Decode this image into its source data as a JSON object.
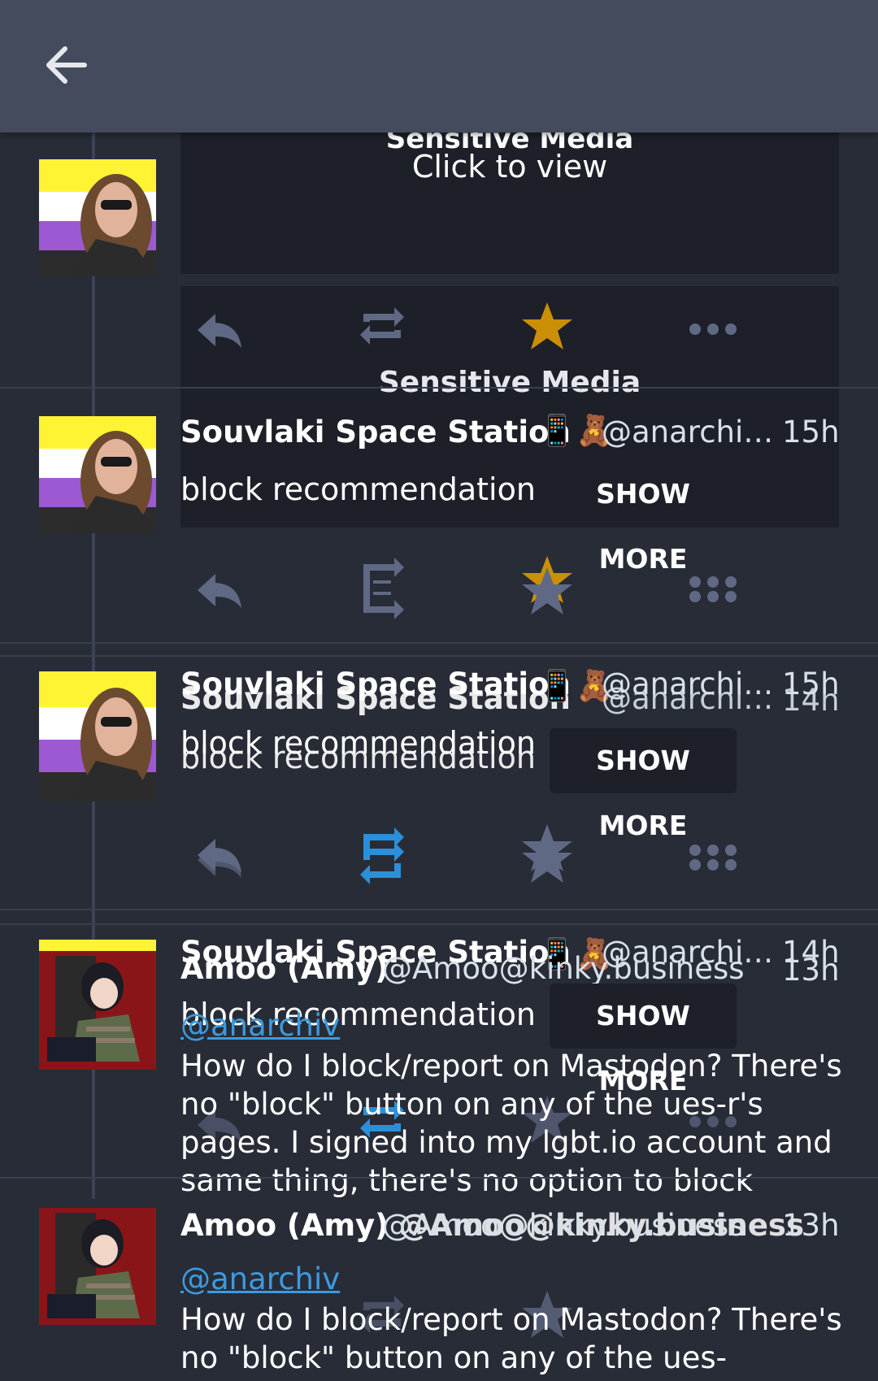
{
  "toolbar": {
    "back_icon": "arrow-left-icon"
  },
  "sensitive": {
    "title": "Sensitive Media",
    "subtitle": "Click to view"
  },
  "colors": {
    "background": "#282c37",
    "toolbar": "#444b5d",
    "favourited": "#ca8f04",
    "boosted": "#2b90d9",
    "icon": "#606984",
    "link": "#3b9be0"
  },
  "post_a": {
    "name": "Souvlaki Space Station",
    "emoji": "📱🧸",
    "handle": "@anarchi…",
    "content_warning": "block recommendation",
    "show_more": "SHOW MORE",
    "time_1": "15h",
    "time_2": "14h"
  },
  "post_b": {
    "name": "Amoo (Amy)",
    "handle": "@Amoo@kinky.business",
    "time": "13h",
    "mention": "@anarchiv",
    "text": "How do I block/report on Mastodon? There's no \"block\" button on any of the ues-r's pages. I signed into my lgbt.io account and same thing, there's no option to block",
    "text_short": "How do I block/report on Mastodon? There's no \"block\" button on any of the ues-",
    "overlap_text": "Amoo (Amy) @Amoo@kinky.business"
  },
  "actions": {
    "reply": "reply-icon",
    "boost": "boost-icon",
    "favourite": "star-icon",
    "more": "more-icon"
  }
}
